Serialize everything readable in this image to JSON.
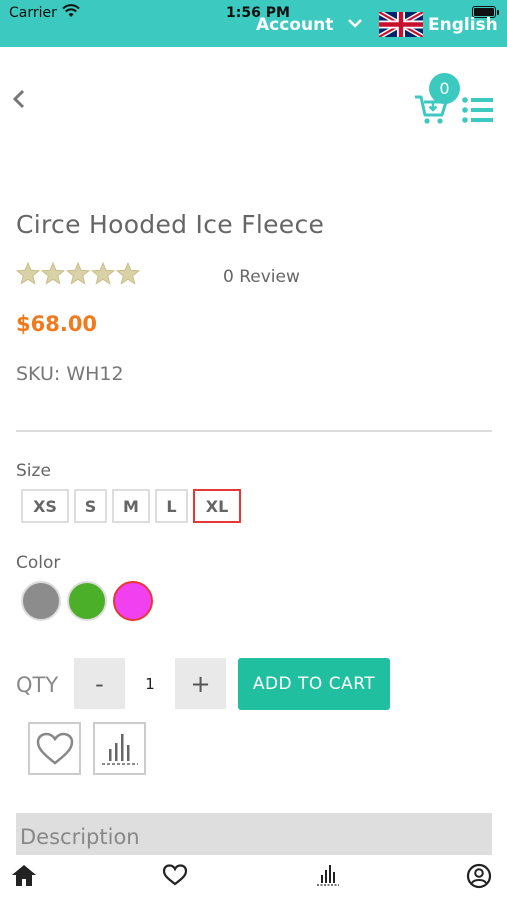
{
  "status_bar": {
    "carrier": "Carrier",
    "time": "1:56 PM"
  },
  "top_bar": {
    "account_label": "Account",
    "language_label": "English",
    "background_color": "#3cc9c0"
  },
  "header": {
    "cart_count": "0"
  },
  "product": {
    "title": "Circe Hooded Ice Fleece",
    "rating": 0,
    "review_text": "0 Review",
    "price": "$68.00",
    "sku": "SKU:  WH12"
  },
  "size": {
    "label": "Size",
    "options": [
      "XS",
      "S",
      "M",
      "L",
      "XL"
    ],
    "selected": "XL"
  },
  "color": {
    "label": "Color",
    "swatches": [
      "#8c8c8c",
      "#4caf2a",
      "#f040f0"
    ],
    "selected_index": 2
  },
  "quantity": {
    "label": "QTY",
    "minus": "-",
    "value": "1",
    "plus": "+"
  },
  "actions": {
    "add_to_cart": "ADD TO CART",
    "wishlist_icon": "heart-icon",
    "compare_icon": "compare-chart-icon"
  },
  "description": {
    "label": "Description"
  },
  "bottom_nav": {
    "items": [
      "home-icon",
      "heart-icon",
      "compare-chart-icon",
      "user-icon"
    ]
  }
}
